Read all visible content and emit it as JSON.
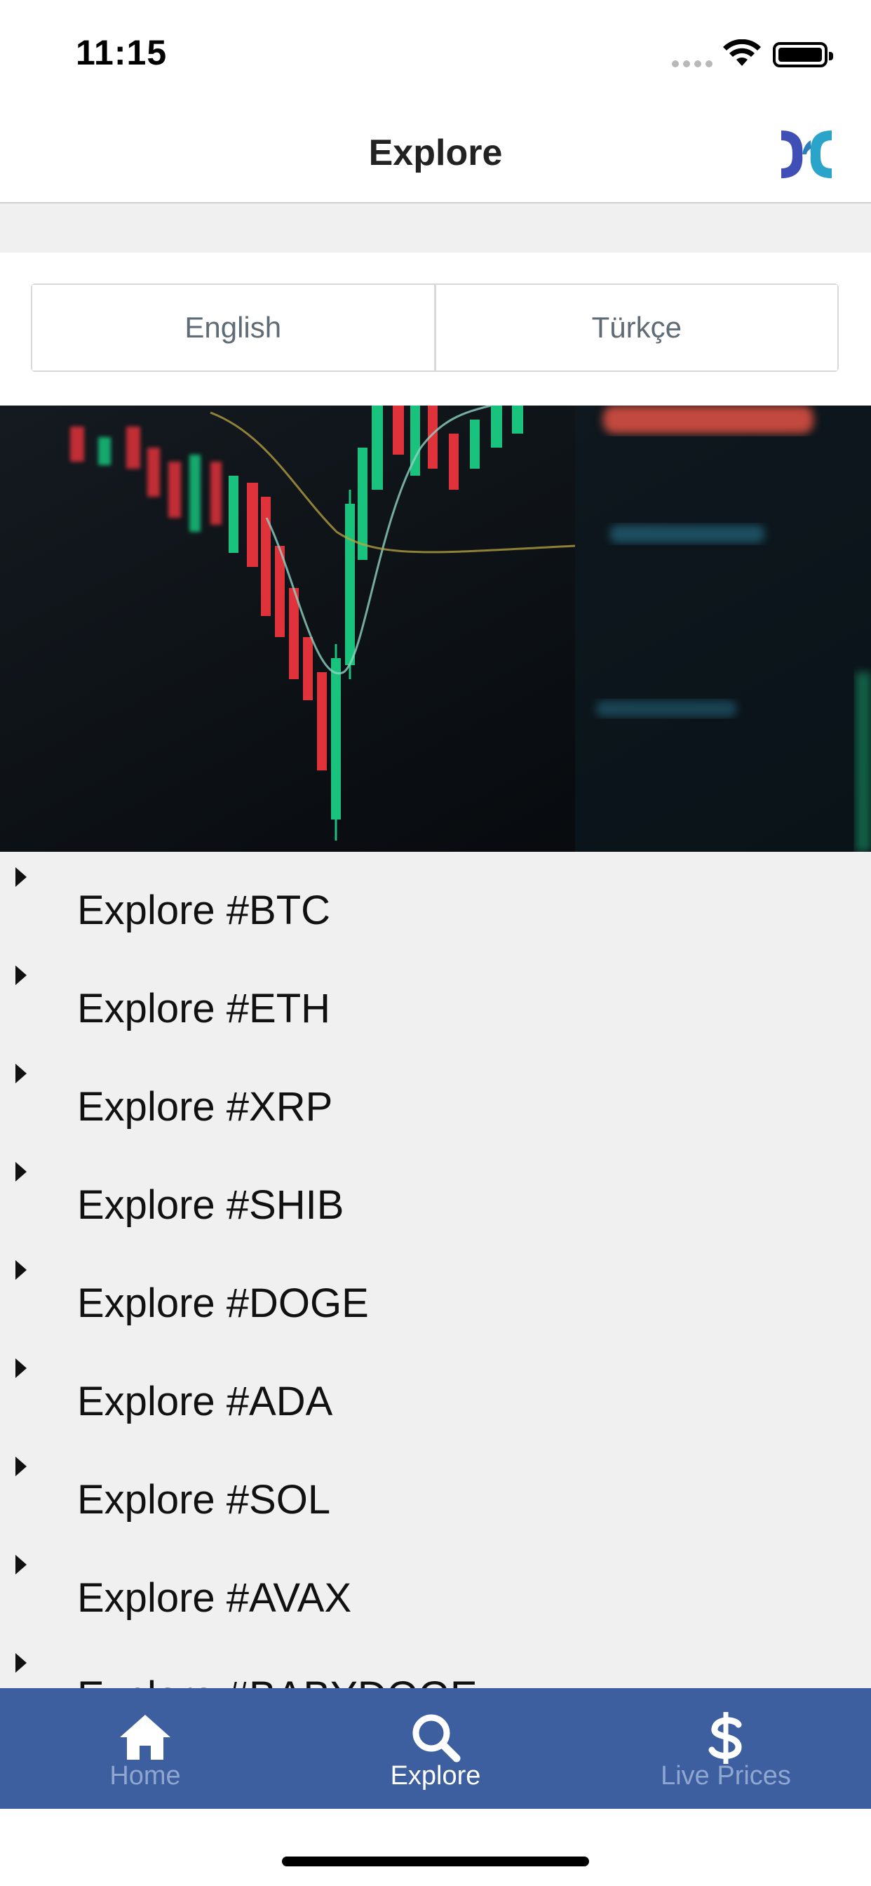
{
  "status_bar": {
    "time": "11:15"
  },
  "navbar": {
    "title": "Explore",
    "logo_icon": "brand-logo-icon"
  },
  "language_toggle": {
    "options": [
      "English",
      "Türkçe"
    ]
  },
  "hero_image": {
    "description_icon": "candlestick-chart-image"
  },
  "explore_list": {
    "items": [
      "Explore #BTC",
      "Explore #ETH",
      "Explore #XRP",
      "Explore #SHIB",
      "Explore #DOGE",
      "Explore #ADA",
      "Explore #SOL",
      "Explore #AVAX",
      "Explore #BABYDOGE"
    ]
  },
  "tab_bar": {
    "tabs": [
      {
        "label": "Home",
        "icon": "home-icon",
        "active": false
      },
      {
        "label": "Explore",
        "icon": "search-icon",
        "active": true
      },
      {
        "label": "Live Prices",
        "icon": "dollar-icon",
        "active": false
      }
    ]
  },
  "colors": {
    "tab_bar_bg": "#3d5f9f",
    "tab_active": "#ffffff",
    "tab_inactive": "#8fa6d0",
    "list_bg": "#f0f0f0",
    "candle_up": "#19c37d",
    "candle_down": "#e0323b"
  }
}
